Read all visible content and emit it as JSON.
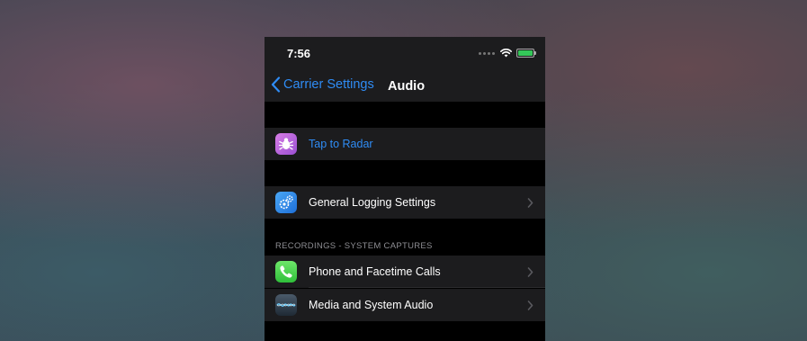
{
  "status_bar": {
    "time": "7:56"
  },
  "nav": {
    "back_label": "Carrier Settings",
    "title": "Audio"
  },
  "rows": {
    "tap_to_radar": {
      "label": "Tap to Radar",
      "icon": "bug-icon"
    },
    "general_logging": {
      "label": "General Logging Settings",
      "icon": "gears-icon"
    },
    "phone_facetime": {
      "label": "Phone and Facetime Calls",
      "icon": "phone-icon"
    },
    "media_system_audio": {
      "label": "Media and System Audio",
      "icon": "waveform-icon"
    }
  },
  "sections": {
    "recordings_header": "RECORDINGS - SYSTEM CAPTURES"
  },
  "colors": {
    "accent": "#2f8cf5",
    "row_background": "#1c1c1e",
    "group_background": "#000000",
    "secondary_text": "#8e8e93"
  }
}
